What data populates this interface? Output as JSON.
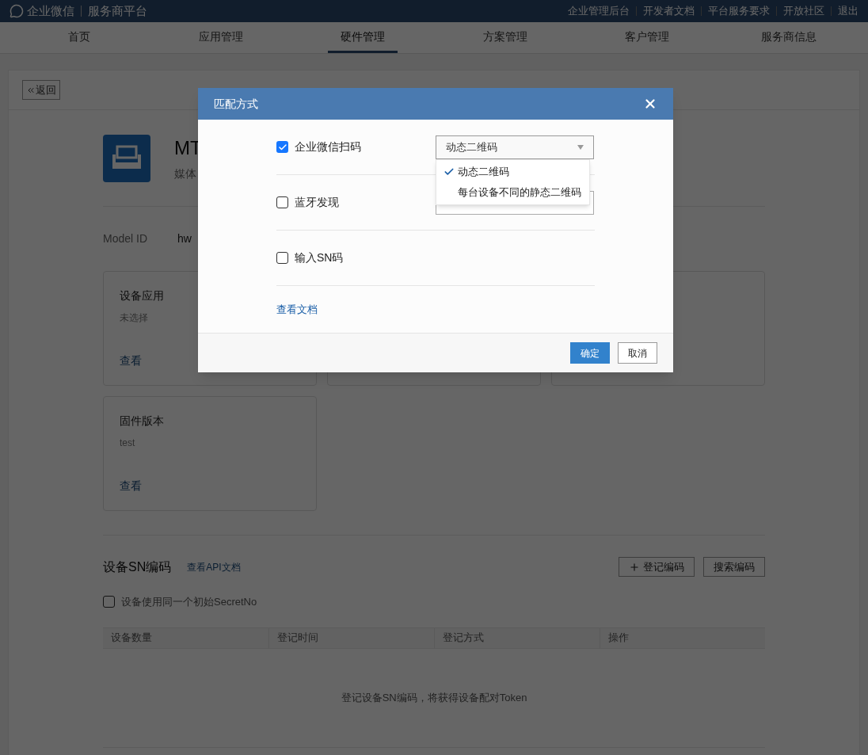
{
  "top_bar": {
    "logo_text": "企业微信",
    "platform": "服务商平台",
    "links": [
      "企业管理后台",
      "开发者文档",
      "平台服务要求",
      "开放社区",
      "退出"
    ]
  },
  "nav": [
    {
      "label": "首页",
      "selected": false
    },
    {
      "label": "应用管理",
      "selected": false
    },
    {
      "label": "硬件管理",
      "selected": true
    },
    {
      "label": "方案管理",
      "selected": false
    },
    {
      "label": "客户管理",
      "selected": false
    },
    {
      "label": "服务商信息",
      "selected": false
    }
  ],
  "page": {
    "back": "返回",
    "device": {
      "name": "MT",
      "subtitle": "媒体"
    },
    "model_id": {
      "label": "Model ID",
      "value": "hw"
    },
    "cards": [
      {
        "kind": "info",
        "title": "设备应用",
        "value": "未选择",
        "link": "查看"
      },
      {
        "kind": "blank"
      },
      {
        "kind": "blank"
      },
      {
        "kind": "info",
        "title": "固件版本",
        "value": "test",
        "link": "查看"
      }
    ]
  },
  "sn_section": {
    "title": "设备SN编码",
    "api_link": "查看API文档",
    "buttons": [
      {
        "label": "登记编码",
        "kind": "add"
      },
      {
        "label": "搜索编码"
      }
    ],
    "checkbox": {
      "label": "设备使用同一个初始SecretNo",
      "checked": false
    },
    "table": {
      "columns": [
        "设备数量",
        "登记时间",
        "登记方式",
        "操作"
      ],
      "empty_text": "登记设备SN编码，将获得设备配对Token"
    }
  },
  "dialog": {
    "title": "匹配方式",
    "rows": [
      {
        "label": "企业微信扫码",
        "checked": true,
        "select": {
          "value": "动态二维码",
          "open": true,
          "options": [
            {
              "label": "动态二维码",
              "selected": true
            },
            {
              "label": "每台设备不同的静态二维码",
              "selected": false
            }
          ]
        }
      },
      {
        "label": "蓝牙发现",
        "checked": false,
        "select": {}
      },
      {
        "label": "输入SN码",
        "checked": false
      }
    ],
    "doc_link": "查看文档",
    "buttons": [
      {
        "label": "确定",
        "kind": "primary"
      },
      {
        "label": "取消",
        "kind": "default"
      }
    ]
  }
}
